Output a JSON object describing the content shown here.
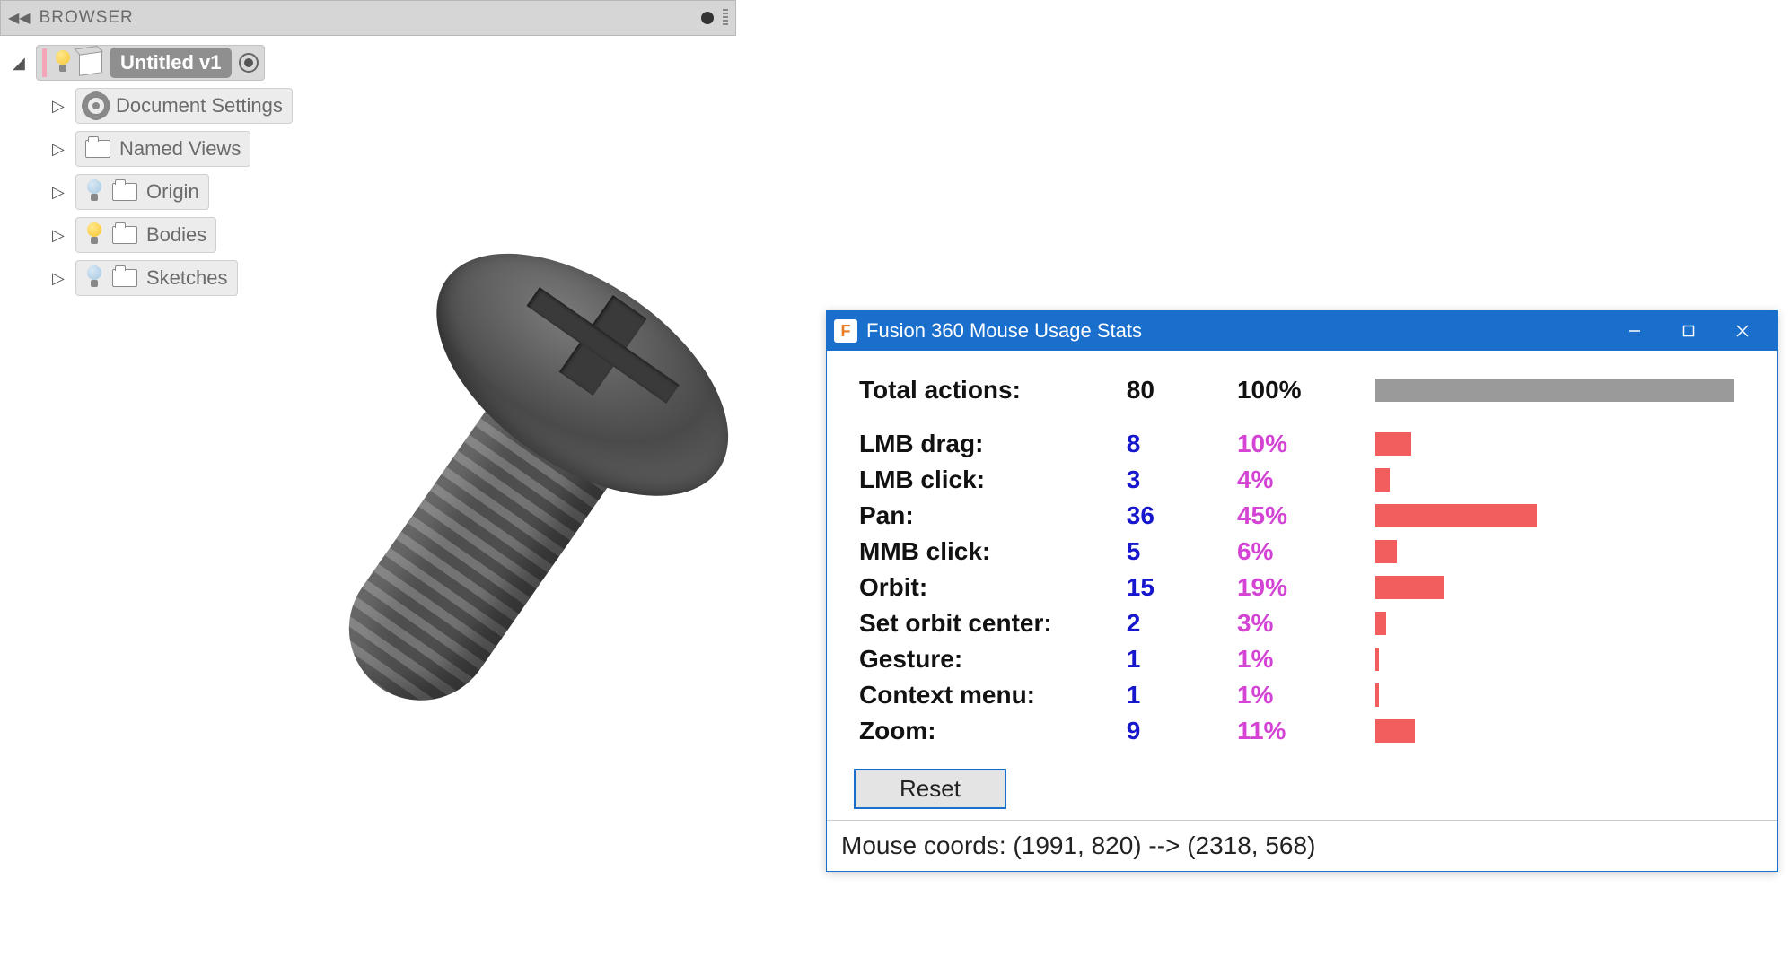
{
  "browser": {
    "title": "BROWSER",
    "root": {
      "label": "Untitled v1"
    },
    "items": [
      {
        "label": "Document Settings",
        "icon": "gear",
        "bulb": null
      },
      {
        "label": "Named Views",
        "icon": "folder",
        "bulb": null
      },
      {
        "label": "Origin",
        "icon": "folder",
        "bulb": "off"
      },
      {
        "label": "Bodies",
        "icon": "folder",
        "bulb": "on"
      },
      {
        "label": "Sketches",
        "icon": "folder",
        "bulb": "off"
      }
    ]
  },
  "stats_dialog": {
    "title": "Fusion 360 Mouse Usage Stats",
    "total_label": "Total actions:",
    "total_count": "80",
    "total_pct": "100%",
    "reset_label": "Reset",
    "footer": "Mouse coords: (1991, 820) --> (2318, 568)"
  },
  "chart_data": {
    "type": "bar",
    "orientation": "horizontal",
    "title": "Fusion 360 Mouse Usage Stats",
    "categories": [
      "LMB drag",
      "LMB click",
      "Pan",
      "MMB click",
      "Orbit",
      "Set orbit center",
      "Gesture",
      "Context menu",
      "Zoom"
    ],
    "values": [
      8,
      3,
      36,
      5,
      15,
      2,
      1,
      1,
      9
    ],
    "percentages": [
      10,
      4,
      45,
      6,
      19,
      3,
      1,
      1,
      11
    ],
    "total": 80,
    "colors": {
      "bar": "#f25d5d",
      "total_bar": "#9a9a9a",
      "count": "#1616cc",
      "pct": "#d444d4"
    }
  }
}
